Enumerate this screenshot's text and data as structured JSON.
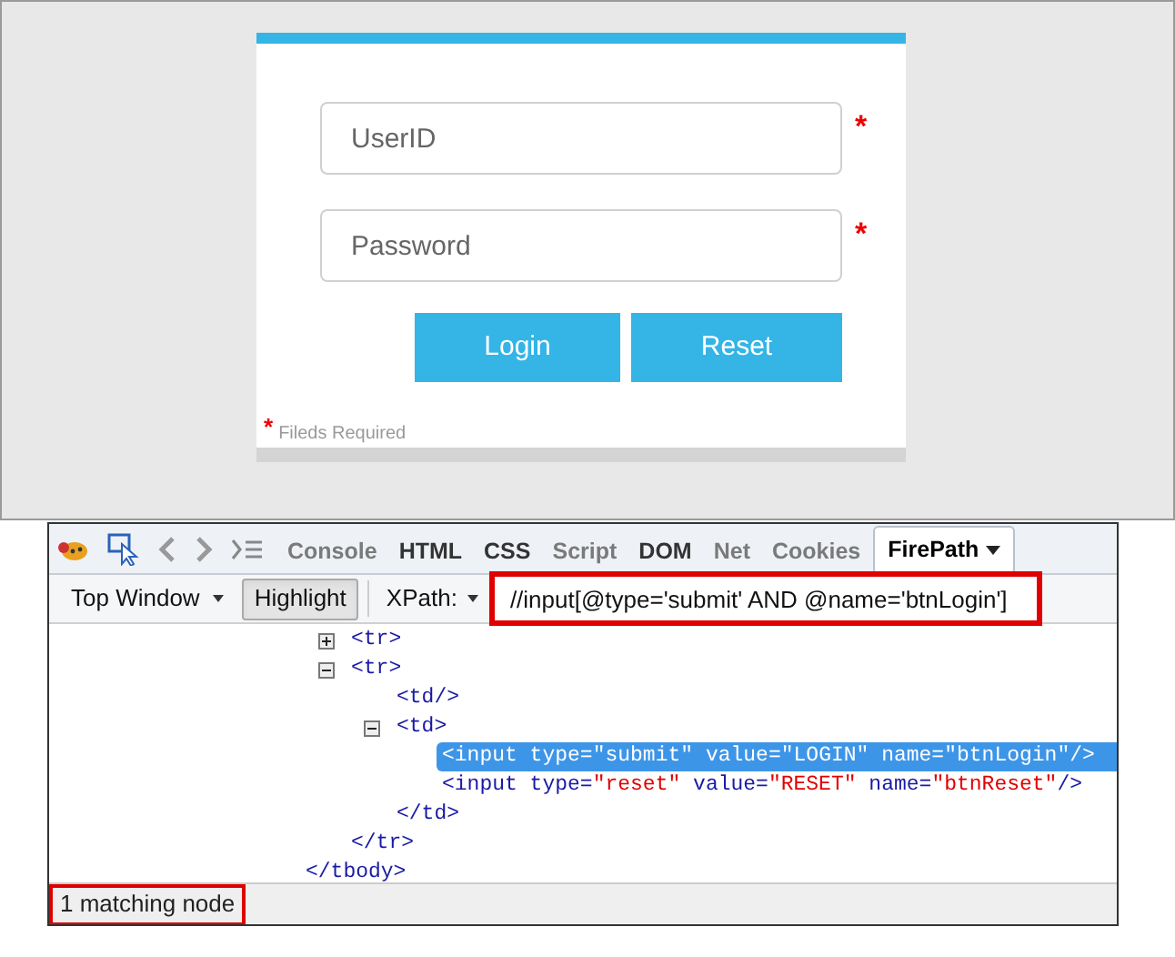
{
  "login_form": {
    "fields": [
      {
        "placeholder": "UserID",
        "required_mark": "*"
      },
      {
        "placeholder": "Password",
        "required_mark": "*"
      }
    ],
    "buttons": [
      "Login",
      "Reset"
    ],
    "note": {
      "mark": "*",
      "text": "Fileds Required"
    }
  },
  "devtools": {
    "tabs": [
      {
        "label": "Console",
        "selected": false,
        "disabled": true
      },
      {
        "label": "HTML",
        "selected": false,
        "disabled": false
      },
      {
        "label": "CSS",
        "selected": false,
        "disabled": false
      },
      {
        "label": "Script",
        "selected": false,
        "disabled": true
      },
      {
        "label": "DOM",
        "selected": false,
        "disabled": false
      },
      {
        "label": "Net",
        "selected": false,
        "disabled": true
      },
      {
        "label": "Cookies",
        "selected": false,
        "disabled": true
      },
      {
        "label": "FirePath",
        "selected": true,
        "disabled": false
      }
    ],
    "toolbar": {
      "frame_menu": "Top Window",
      "highlight": {
        "label": "Highlight",
        "on": true
      },
      "query_type": "XPath:",
      "query": "//input[@type='submit' AND @name='btnLogin']"
    },
    "tree": {
      "children": [
        {
          "tokens": [
            {
              "text": "<tr>",
              "kind": "tag"
            }
          ],
          "expanded": false
        },
        {
          "tokens": [
            {
              "text": "<tr>",
              "kind": "tag"
            }
          ],
          "expanded": true,
          "children": [
            {
              "tokens": [
                {
                  "text": "<td/>",
                  "kind": "tag"
                }
              ]
            },
            {
              "tokens": [
                {
                  "text": "<td>",
                  "kind": "tag"
                }
              ],
              "expanded": true,
              "children": [
                {
                  "tokens": [
                    {
                      "text": "<input type=",
                      "kind": "tag"
                    },
                    {
                      "text": "\"submit\"",
                      "kind": "value"
                    },
                    {
                      "text": " value=",
                      "kind": "tag"
                    },
                    {
                      "text": "\"LOGIN\"",
                      "kind": "value"
                    },
                    {
                      "text": " name=",
                      "kind": "tag"
                    },
                    {
                      "text": "\"btnLogin\"",
                      "kind": "value"
                    },
                    {
                      "text": "/>",
                      "kind": "tag"
                    }
                  ],
                  "selected": true
                },
                {
                  "tokens": [
                    {
                      "text": "<input type=",
                      "kind": "tag"
                    },
                    {
                      "text": "\"reset\"",
                      "kind": "value"
                    },
                    {
                      "text": " value=",
                      "kind": "tag"
                    },
                    {
                      "text": "\"RESET\"",
                      "kind": "value"
                    },
                    {
                      "text": " name=",
                      "kind": "tag"
                    },
                    {
                      "text": "\"btnReset\"",
                      "kind": "value"
                    },
                    {
                      "text": "/>",
                      "kind": "tag"
                    }
                  ],
                  "selected": false
                }
              ],
              "closing": [
                {
                  "text": "</td>",
                  "kind": "tag"
                }
              ]
            }
          ],
          "closing": [
            {
              "text": "</tr>",
              "kind": "tag"
            }
          ]
        }
      ],
      "closing": [
        {
          "text": "</tbody>",
          "kind": "tag"
        }
      ]
    },
    "status": "1 matching node"
  }
}
